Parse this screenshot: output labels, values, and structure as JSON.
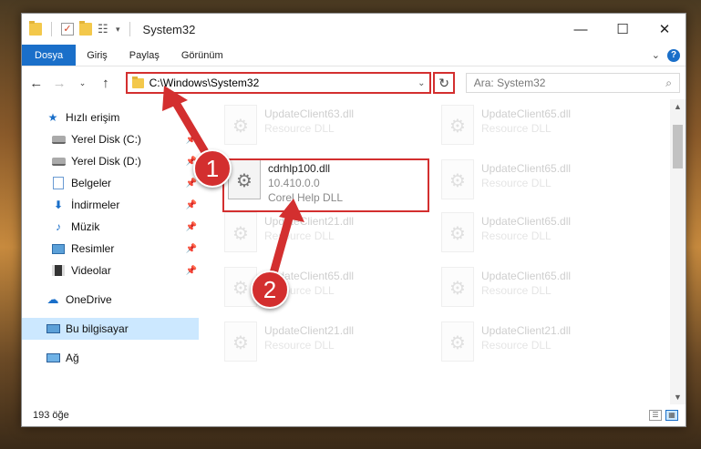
{
  "window": {
    "title": "System32",
    "controls": {
      "minimize": "—",
      "maximize": "☐",
      "close": "✕"
    }
  },
  "ribbon": {
    "tabs": [
      "Dosya",
      "Giriş",
      "Paylaş",
      "Görünüm"
    ],
    "active": "Dosya"
  },
  "navbar": {
    "address": "C:\\Windows\\System32",
    "search_placeholder": "Ara: System32"
  },
  "sidebar": {
    "items": [
      {
        "label": "Hızlı erişim",
        "icon": "star-icon",
        "level": 1,
        "pinned": false
      },
      {
        "label": "Yerel Disk (C:)",
        "icon": "disk-icon",
        "level": 2,
        "pinned": true
      },
      {
        "label": "Yerel Disk (D:)",
        "icon": "disk-icon",
        "level": 2,
        "pinned": true
      },
      {
        "label": "Belgeler",
        "icon": "document-icon",
        "level": 2,
        "pinned": true
      },
      {
        "label": "İndirmeler",
        "icon": "download-icon",
        "level": 2,
        "pinned": true
      },
      {
        "label": "Müzik",
        "icon": "music-icon",
        "level": 2,
        "pinned": true
      },
      {
        "label": "Resimler",
        "icon": "pictures-icon",
        "level": 2,
        "pinned": true
      },
      {
        "label": "Videolar",
        "icon": "video-icon",
        "level": 2,
        "pinned": true
      },
      {
        "label": "OneDrive",
        "icon": "cloud-icon",
        "level": 1,
        "pinned": false
      },
      {
        "label": "Bu bilgisayar",
        "icon": "computer-icon",
        "level": 1,
        "pinned": false,
        "selected": true
      },
      {
        "label": "Ağ",
        "icon": "network-icon",
        "level": 1,
        "pinned": false
      }
    ]
  },
  "files": {
    "focus": {
      "name": "cdrhlp100.dll",
      "version": "10.410.0.0",
      "description": "Corel Help DLL"
    },
    "ghosts": [
      {
        "name": "UpdateClient63.dll",
        "description": "Resource DLL"
      },
      {
        "name": "UpdateClient65.dll",
        "description": "Resource DLL"
      },
      {
        "name": "UpdateClient65.dll",
        "description": "Resource DLL"
      },
      {
        "name": "UpdateClient21.dll",
        "description": "Resource DLL"
      },
      {
        "name": "UpdateClient65.dll",
        "description": "Resource DLL"
      },
      {
        "name": "UpdateClient65.dll",
        "description": "Resource DLL"
      },
      {
        "name": "UpdateClient65.dll",
        "description": "Resource DLL"
      },
      {
        "name": "UpdateClient21.dll",
        "description": "Resource DLL"
      },
      {
        "name": "UpdateClient21.dll",
        "description": "Resource DLL"
      }
    ]
  },
  "status": {
    "count": "193 öğe"
  },
  "annotations": {
    "step1": "1",
    "step2": "2",
    "color": "#d32f2f"
  }
}
